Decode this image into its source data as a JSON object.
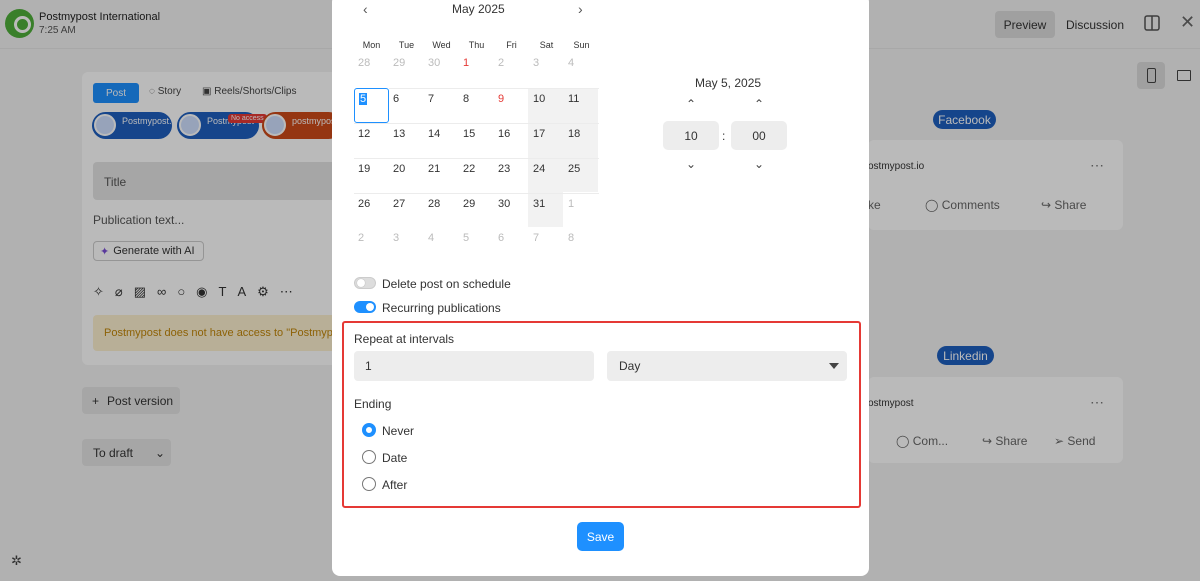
{
  "app": {
    "org_name": "Postmypost International",
    "time": "7:25 AM",
    "preview_tab": "Preview",
    "discussion_tab": "Discussion"
  },
  "editor": {
    "tabs": [
      "Post",
      "Story",
      "Reels/Shorts/Clips"
    ],
    "accounts": [
      {
        "name": "Postmypost.io",
        "network": "facebook"
      },
      {
        "name": "Postmypost",
        "network": "linkedin",
        "badge": "No access"
      },
      {
        "name": "postmypost",
        "network": "reddit"
      }
    ],
    "title_placeholder": "Title",
    "publication_placeholder": "Publication text...",
    "generate_ai": "Generate with AI",
    "warning": "Postmypost does not have access to \"Postmypost\"",
    "post_version": "Post version",
    "to_draft": "To draft"
  },
  "preview": {
    "facebook_label": "Facebook",
    "facebook_account": "ostmypost.io",
    "facebook_actions": [
      "ke",
      "Comments",
      "Share"
    ],
    "linkedin_label": "Linkedin",
    "linkedin_account": "ostmypost",
    "linkedin_actions": [
      "Com...",
      "Share",
      "Send"
    ]
  },
  "calendar": {
    "month": "May 2025",
    "weekdays": [
      "Mon",
      "Tue",
      "Wed",
      "Thu",
      "Fri",
      "Sat",
      "Sun"
    ],
    "weeks": [
      [
        "28",
        "29",
        "30",
        "1",
        "2",
        "3",
        "4"
      ],
      [
        "5",
        "6",
        "7",
        "8",
        "9",
        "10",
        "11"
      ],
      [
        "12",
        "13",
        "14",
        "15",
        "16",
        "17",
        "18"
      ],
      [
        "19",
        "20",
        "21",
        "22",
        "23",
        "24",
        "25"
      ],
      [
        "26",
        "27",
        "28",
        "29",
        "30",
        "31",
        "1"
      ],
      [
        "2",
        "3",
        "4",
        "5",
        "6",
        "7",
        "8"
      ]
    ],
    "selected_day": "5",
    "selected_date": "May 5, 2025",
    "hour": "10",
    "minute": "00"
  },
  "options": {
    "delete_on_schedule": {
      "label": "Delete post on schedule",
      "enabled": false
    },
    "recurring": {
      "label": "Recurring publications",
      "enabled": true
    }
  },
  "recurrence": {
    "title": "Repeat at intervals",
    "interval_value": "1",
    "unit": "Day",
    "ending_title": "Ending",
    "ending_options": [
      "Never",
      "Date",
      "After"
    ],
    "ending_selected": "Never"
  },
  "save_label": "Save",
  "colors": {
    "accent": "#1e90ff",
    "highlight_border": "#e53935",
    "holiday": "#e53935"
  }
}
